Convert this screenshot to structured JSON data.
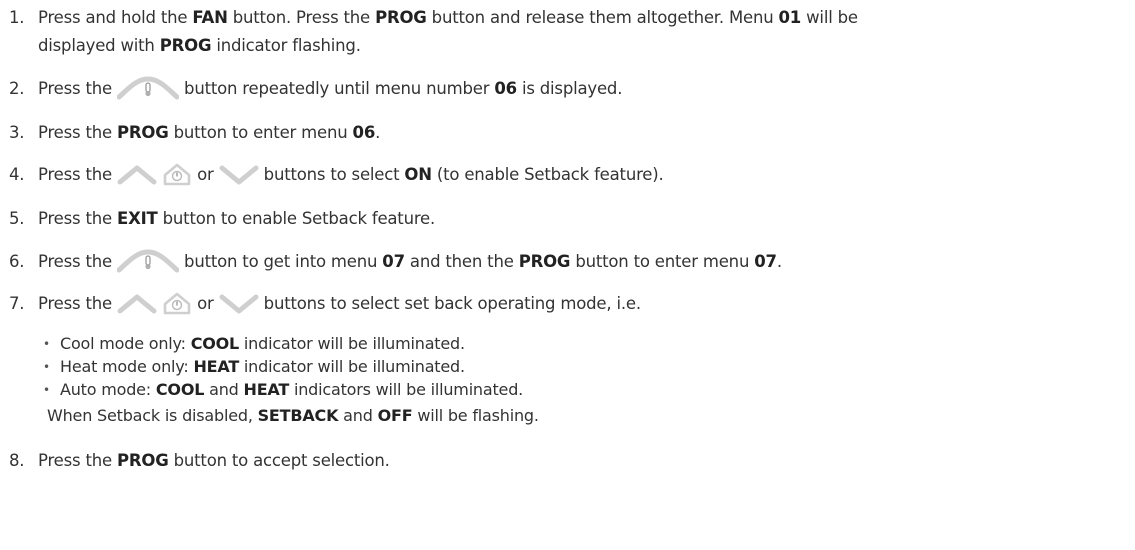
{
  "colors": {
    "text": "#333333",
    "icon": "#cfcfcf"
  },
  "icons": {
    "temp_button": "thermometer-arch-icon",
    "up_button": "chevron-up-icon",
    "home_button": "home-thermometer-icon",
    "down_button": "chevron-down-icon"
  },
  "steps": [
    {
      "num": "1.",
      "a": "Press and hold the ",
      "b": "FAN",
      "c": " button. Press the ",
      "d": "PROG",
      "e": " button and release them altogether. Menu ",
      "f": "01",
      "g": " will be",
      "cont_a": "displayed with ",
      "cont_b": "PROG",
      "cont_c": " indicator flashing."
    },
    {
      "num": "2.",
      "a": "Press the ",
      "b": " button repeatedly until menu number ",
      "c": "06",
      "d": " is displayed."
    },
    {
      "num": "3.",
      "a": "Press the ",
      "b": "PROG",
      "c": " button to enter menu ",
      "d": "06",
      "e": "."
    },
    {
      "num": "4.",
      "a": "Press the ",
      "b": " or ",
      "c": " buttons to select ",
      "d": "ON",
      "e": " (to enable Setback feature)."
    },
    {
      "num": "5.",
      "a": "Press the ",
      "b": "EXIT",
      "c": " button to enable Setback feature."
    },
    {
      "num": "6.",
      "a": "Press the ",
      "b": " button to get into menu ",
      "c": "07",
      "d": " and then the ",
      "e": "PROG",
      "f": " button to enter menu ",
      "g": "07",
      "h": "."
    },
    {
      "num": "7.",
      "a": "Press the ",
      "b": " or ",
      "c": " buttons to select set back operating mode, i.e."
    },
    {
      "num": "8.",
      "a": "Press the ",
      "b": "PROG",
      "c": " button to accept selection."
    }
  ],
  "bullets": [
    {
      "dot": "•",
      "a": "Cool mode only: ",
      "b": "COOL",
      "c": " indicator will be illuminated."
    },
    {
      "dot": "•",
      "a": "Heat mode only: ",
      "b": "HEAT",
      "c": " indicator will be illuminated."
    },
    {
      "dot": "•",
      "a": "Auto mode: ",
      "b": "COOL",
      "c": " and ",
      "d": "HEAT",
      "e": " indicators will be illuminated."
    }
  ],
  "note": {
    "a": "When Setback is disabled, ",
    "b": "SETBACK",
    "c": " and ",
    "d": "OFF",
    "e": " will be flashing."
  }
}
